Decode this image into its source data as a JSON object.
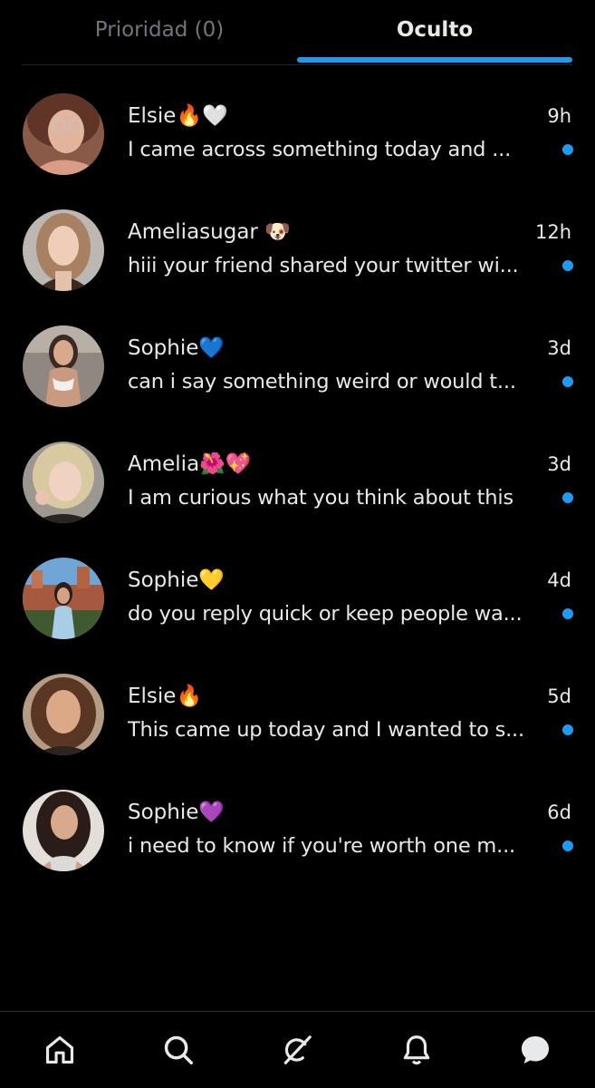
{
  "tabs": {
    "priority": "Prioridad (0)",
    "hidden": "Oculto"
  },
  "conversations": [
    {
      "name": "Elsie🔥🤍",
      "time": "9h",
      "preview": "I came across something today and ...",
      "unread": true
    },
    {
      "name": "Ameliasugar 🐶",
      "time": "12h",
      "preview": "hiii your friend shared your twitter wi...",
      "unread": true
    },
    {
      "name": "Sophie💙",
      "time": "3d",
      "preview": "can i say something weird or would t...",
      "unread": true
    },
    {
      "name": "Amelia🌺💖",
      "time": "3d",
      "preview": "I am curious what you think about this",
      "unread": true
    },
    {
      "name": "Sophie💛",
      "time": "4d",
      "preview": "do you reply quick or keep people wa...",
      "unread": true
    },
    {
      "name": "Elsie🔥",
      "time": "5d",
      "preview": "This came up today and I wanted to s...",
      "unread": true
    },
    {
      "name": "Sophie💜",
      "time": "6d",
      "preview": "i need to know if you're worth one m...",
      "unread": true
    }
  ],
  "nav": {
    "items": [
      "home-icon",
      "search-icon",
      "grok-icon",
      "bell-icon",
      "messages-icon"
    ]
  },
  "colors": {
    "accent": "#1d9bf0",
    "background": "#000000",
    "text": "#e7e9ea",
    "muted": "#71767b"
  }
}
